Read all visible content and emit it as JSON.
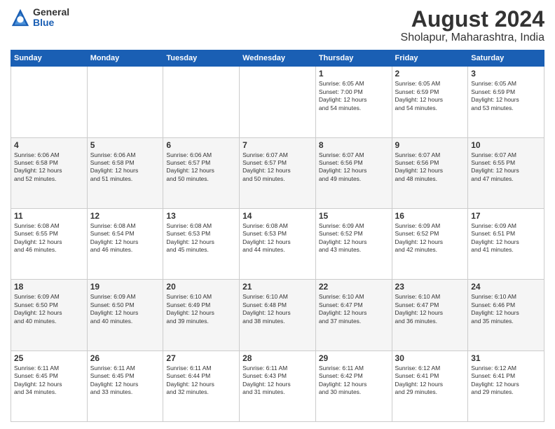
{
  "logo": {
    "general": "General",
    "blue": "Blue"
  },
  "title": "August 2024",
  "subtitle": "Sholapur, Maharashtra, India",
  "weekdays": [
    "Sunday",
    "Monday",
    "Tuesday",
    "Wednesday",
    "Thursday",
    "Friday",
    "Saturday"
  ],
  "weeks": [
    [
      {
        "day": "",
        "info": ""
      },
      {
        "day": "",
        "info": ""
      },
      {
        "day": "",
        "info": ""
      },
      {
        "day": "",
        "info": ""
      },
      {
        "day": "1",
        "info": "Sunrise: 6:05 AM\nSunset: 7:00 PM\nDaylight: 12 hours\nand 54 minutes."
      },
      {
        "day": "2",
        "info": "Sunrise: 6:05 AM\nSunset: 6:59 PM\nDaylight: 12 hours\nand 54 minutes."
      },
      {
        "day": "3",
        "info": "Sunrise: 6:05 AM\nSunset: 6:59 PM\nDaylight: 12 hours\nand 53 minutes."
      }
    ],
    [
      {
        "day": "4",
        "info": "Sunrise: 6:06 AM\nSunset: 6:58 PM\nDaylight: 12 hours\nand 52 minutes."
      },
      {
        "day": "5",
        "info": "Sunrise: 6:06 AM\nSunset: 6:58 PM\nDaylight: 12 hours\nand 51 minutes."
      },
      {
        "day": "6",
        "info": "Sunrise: 6:06 AM\nSunset: 6:57 PM\nDaylight: 12 hours\nand 50 minutes."
      },
      {
        "day": "7",
        "info": "Sunrise: 6:07 AM\nSunset: 6:57 PM\nDaylight: 12 hours\nand 50 minutes."
      },
      {
        "day": "8",
        "info": "Sunrise: 6:07 AM\nSunset: 6:56 PM\nDaylight: 12 hours\nand 49 minutes."
      },
      {
        "day": "9",
        "info": "Sunrise: 6:07 AM\nSunset: 6:56 PM\nDaylight: 12 hours\nand 48 minutes."
      },
      {
        "day": "10",
        "info": "Sunrise: 6:07 AM\nSunset: 6:55 PM\nDaylight: 12 hours\nand 47 minutes."
      }
    ],
    [
      {
        "day": "11",
        "info": "Sunrise: 6:08 AM\nSunset: 6:55 PM\nDaylight: 12 hours\nand 46 minutes."
      },
      {
        "day": "12",
        "info": "Sunrise: 6:08 AM\nSunset: 6:54 PM\nDaylight: 12 hours\nand 46 minutes."
      },
      {
        "day": "13",
        "info": "Sunrise: 6:08 AM\nSunset: 6:53 PM\nDaylight: 12 hours\nand 45 minutes."
      },
      {
        "day": "14",
        "info": "Sunrise: 6:08 AM\nSunset: 6:53 PM\nDaylight: 12 hours\nand 44 minutes."
      },
      {
        "day": "15",
        "info": "Sunrise: 6:09 AM\nSunset: 6:52 PM\nDaylight: 12 hours\nand 43 minutes."
      },
      {
        "day": "16",
        "info": "Sunrise: 6:09 AM\nSunset: 6:52 PM\nDaylight: 12 hours\nand 42 minutes."
      },
      {
        "day": "17",
        "info": "Sunrise: 6:09 AM\nSunset: 6:51 PM\nDaylight: 12 hours\nand 41 minutes."
      }
    ],
    [
      {
        "day": "18",
        "info": "Sunrise: 6:09 AM\nSunset: 6:50 PM\nDaylight: 12 hours\nand 40 minutes."
      },
      {
        "day": "19",
        "info": "Sunrise: 6:09 AM\nSunset: 6:50 PM\nDaylight: 12 hours\nand 40 minutes."
      },
      {
        "day": "20",
        "info": "Sunrise: 6:10 AM\nSunset: 6:49 PM\nDaylight: 12 hours\nand 39 minutes."
      },
      {
        "day": "21",
        "info": "Sunrise: 6:10 AM\nSunset: 6:48 PM\nDaylight: 12 hours\nand 38 minutes."
      },
      {
        "day": "22",
        "info": "Sunrise: 6:10 AM\nSunset: 6:47 PM\nDaylight: 12 hours\nand 37 minutes."
      },
      {
        "day": "23",
        "info": "Sunrise: 6:10 AM\nSunset: 6:47 PM\nDaylight: 12 hours\nand 36 minutes."
      },
      {
        "day": "24",
        "info": "Sunrise: 6:10 AM\nSunset: 6:46 PM\nDaylight: 12 hours\nand 35 minutes."
      }
    ],
    [
      {
        "day": "25",
        "info": "Sunrise: 6:11 AM\nSunset: 6:45 PM\nDaylight: 12 hours\nand 34 minutes."
      },
      {
        "day": "26",
        "info": "Sunrise: 6:11 AM\nSunset: 6:45 PM\nDaylight: 12 hours\nand 33 minutes."
      },
      {
        "day": "27",
        "info": "Sunrise: 6:11 AM\nSunset: 6:44 PM\nDaylight: 12 hours\nand 32 minutes."
      },
      {
        "day": "28",
        "info": "Sunrise: 6:11 AM\nSunset: 6:43 PM\nDaylight: 12 hours\nand 31 minutes."
      },
      {
        "day": "29",
        "info": "Sunrise: 6:11 AM\nSunset: 6:42 PM\nDaylight: 12 hours\nand 30 minutes."
      },
      {
        "day": "30",
        "info": "Sunrise: 6:12 AM\nSunset: 6:41 PM\nDaylight: 12 hours\nand 29 minutes."
      },
      {
        "day": "31",
        "info": "Sunrise: 6:12 AM\nSunset: 6:41 PM\nDaylight: 12 hours\nand 29 minutes."
      }
    ]
  ]
}
